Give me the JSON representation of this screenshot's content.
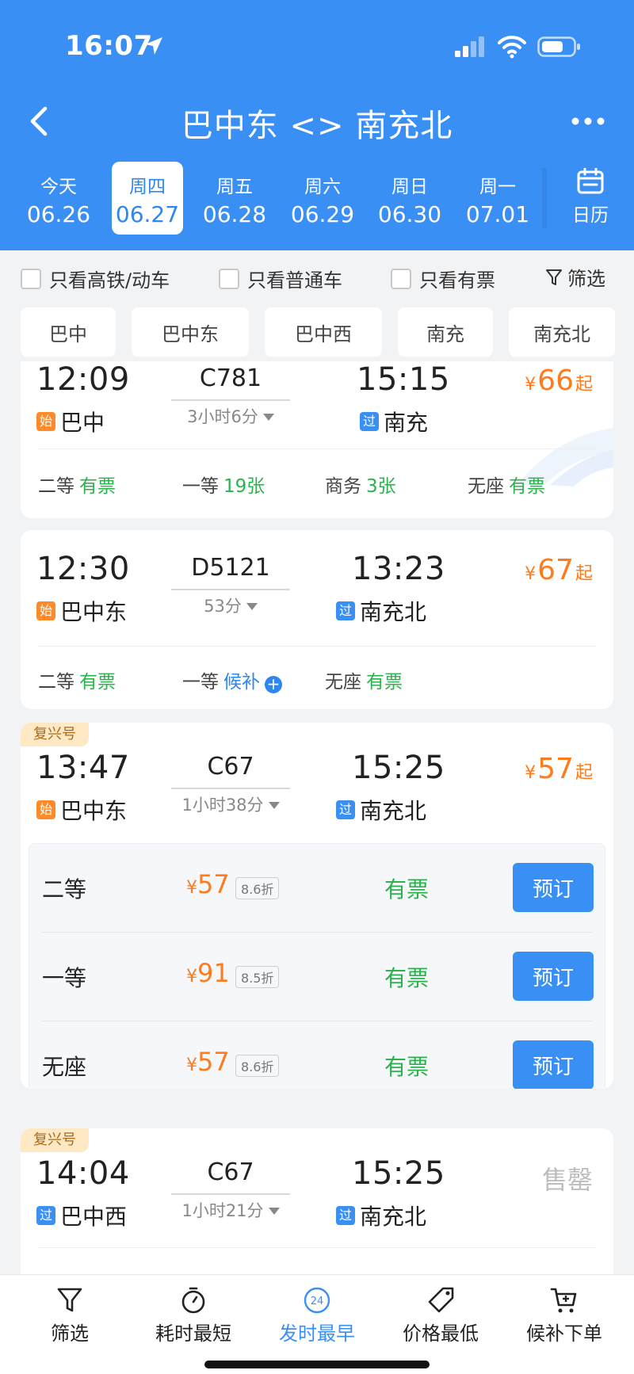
{
  "status": {
    "time": "16:07"
  },
  "nav": {
    "title": "巴中东 <> 南充北"
  },
  "dates": [
    {
      "weekday": "今天",
      "date": "06.26"
    },
    {
      "weekday": "周四",
      "date": "06.27"
    },
    {
      "weekday": "周五",
      "date": "06.28"
    },
    {
      "weekday": "周六",
      "date": "06.29"
    },
    {
      "weekday": "周日",
      "date": "06.30"
    },
    {
      "weekday": "周一",
      "date": "07.01"
    }
  ],
  "selected_date_index": 1,
  "calendar_label": "日历",
  "filters": {
    "high_speed": "只看高铁/动车",
    "normal": "只看普通车",
    "available": "只看有票",
    "filter_label": "筛选"
  },
  "stations": [
    "巴中",
    "巴中东",
    "巴中西",
    "南充",
    "南充北"
  ],
  "trains": [
    {
      "dep_time": "12:09",
      "train_no": "C781",
      "duration": "3小时6分",
      "arr_time": "15:15",
      "dep_tag": "始",
      "dep_station": "巴中",
      "arr_tag": "过",
      "arr_station": "南充",
      "price_yen": "¥",
      "price": "66",
      "price_suffix": "起",
      "seats": [
        {
          "name": "二等",
          "status": "有票"
        },
        {
          "name": "一等",
          "status": "19张"
        },
        {
          "name": "商务",
          "status": "3张"
        },
        {
          "name": "无座",
          "status": "有票"
        }
      ]
    },
    {
      "dep_time": "12:30",
      "train_no": "D5121",
      "duration": "53分",
      "arr_time": "13:23",
      "dep_tag": "始",
      "dep_station": "巴中东",
      "arr_tag": "过",
      "arr_station": "南充北",
      "price_yen": "¥",
      "price": "67",
      "price_suffix": "起",
      "seats": [
        {
          "name": "二等",
          "status": "有票"
        },
        {
          "name": "一等",
          "status": "候补"
        },
        {
          "name": "无座",
          "status": "有票"
        }
      ]
    },
    {
      "badge": "复兴号",
      "dep_time": "13:47",
      "train_no": "C67",
      "duration": "1小时38分",
      "arr_time": "15:25",
      "dep_tag": "始",
      "dep_station": "巴中东",
      "arr_tag": "过",
      "arr_station": "南充北",
      "price_yen": "¥",
      "price": "57",
      "price_suffix": "起",
      "seat_details": [
        {
          "name": "二等",
          "yen": "¥",
          "price": "57",
          "discount": "8.6折",
          "status": "有票",
          "button": "预订"
        },
        {
          "name": "一等",
          "yen": "¥",
          "price": "91",
          "discount": "8.5折",
          "status": "有票",
          "button": "预订"
        },
        {
          "name": "无座",
          "yen": "¥",
          "price": "57",
          "discount": "8.6折",
          "status": "有票",
          "button": "预订"
        }
      ]
    },
    {
      "badge": "复兴号",
      "dep_time": "14:04",
      "train_no": "C67",
      "duration": "1小时21分",
      "arr_time": "15:25",
      "dep_tag": "过",
      "dep_station": "巴中西",
      "arr_tag": "过",
      "arr_station": "南充北",
      "sold_out": "售罄"
    }
  ],
  "bottom_tabs": [
    {
      "label": "筛选",
      "icon": "filter-icon"
    },
    {
      "label": "耗时最短",
      "icon": "timer-icon"
    },
    {
      "label": "发时最早",
      "icon": "clock-24-icon",
      "icon_text": "24"
    },
    {
      "label": "价格最低",
      "icon": "price-tag-icon"
    },
    {
      "label": "候补下单",
      "icon": "cart-plus-icon"
    }
  ],
  "active_tab_index": 2,
  "colors": {
    "header": "#3a8ff5",
    "price": "#ff7b1c",
    "available": "#2bb24c",
    "accent": "#2e86f0",
    "sold_out": "#bdbdbd"
  }
}
